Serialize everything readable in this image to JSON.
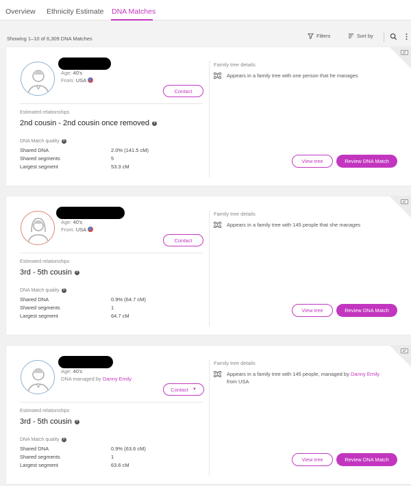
{
  "tabs": [
    {
      "label": "Overview"
    },
    {
      "label": "Ethnicity Estimate"
    },
    {
      "label": "DNA Matches"
    }
  ],
  "colors": {
    "accent": "#c236bf",
    "male_avatar": "#8fb1d3",
    "female_avatar": "#d98a74"
  },
  "toolbar": {
    "showing": "Showing 1–10 of 6,309 DNA Matches",
    "filters_label": "Filters",
    "sort_label": "Sort by",
    "icons": [
      "filter-icon",
      "sort-icon",
      "search-icon",
      "more-vertical-icon"
    ]
  },
  "labels": {
    "age": "Age:",
    "from": "From:",
    "managed_by": "DNA managed by",
    "estimated_relationships": "Estimated relationships",
    "match_quality": "DNA Match quality",
    "shared_dna": "Shared DNA",
    "shared_segments": "Shared segments",
    "largest_segment": "Largest segment",
    "family_tree_details": "Family tree details",
    "contact": "Contact",
    "view_tree": "View tree",
    "review": "Review DNA Match"
  },
  "matches": [
    {
      "avatar": "male-avatar-icon",
      "age": "40's",
      "from": "USA",
      "relationship": "2nd cousin - 2nd cousin once removed",
      "shared_dna": "2.0% (141.5 cM)",
      "shared_segments": "5",
      "largest_segment": "53.3 cM",
      "tree_text": "Appears in a family tree with one person that he manages"
    },
    {
      "avatar": "female-avatar-icon",
      "age": "40's",
      "from": "USA",
      "relationship": "3rd - 5th cousin",
      "shared_dna": "0.9% (64.7 cM)",
      "shared_segments": "1",
      "largest_segment": "64.7 cM",
      "tree_text": "Appears in a family tree with 145 people that she manages"
    },
    {
      "avatar": "male-avatar-icon",
      "age": "40's",
      "managed_by": "Danny Emily",
      "relationship": "3rd - 5th cousin",
      "shared_dna": "0.9% (63.6 cM)",
      "shared_segments": "1",
      "largest_segment": "63.6 cM",
      "tree_text_a": "Appears in a family tree with 145 people, managed by",
      "tree_link": "Danny Emily",
      "tree_text_b": "from USA"
    }
  ]
}
